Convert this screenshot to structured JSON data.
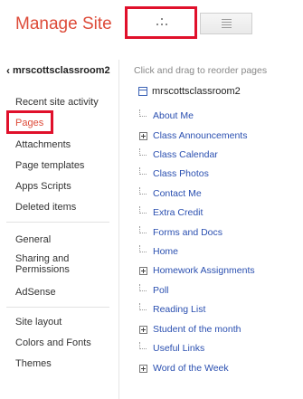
{
  "header": {
    "title": "Manage Site"
  },
  "view_toggle": {
    "tree_label": "Tree view",
    "list_label": "List view",
    "selected": "tree"
  },
  "sidebar": {
    "site_link": "mrscottsclassroom2",
    "groups": [
      [
        "Recent site activity",
        "Pages",
        "Attachments",
        "Page templates",
        "Apps Scripts",
        "Deleted items"
      ],
      [
        "General",
        "Sharing and Permissions",
        "AdSense"
      ],
      [
        "Site layout",
        "Colors and Fonts",
        "Themes"
      ]
    ],
    "active": "Pages"
  },
  "main": {
    "hint": "Click and drag to reorder pages",
    "root": "mrscottsclassroom2",
    "pages": [
      {
        "label": "About Me",
        "expandable": false
      },
      {
        "label": "Class Announcements",
        "expandable": true
      },
      {
        "label": "Class Calendar",
        "expandable": false
      },
      {
        "label": "Class Photos",
        "expandable": false
      },
      {
        "label": "Contact Me",
        "expandable": false
      },
      {
        "label": "Extra Credit",
        "expandable": false
      },
      {
        "label": "Forms and Docs",
        "expandable": false
      },
      {
        "label": "Home",
        "expandable": false
      },
      {
        "label": "Homework Assignments",
        "expandable": true
      },
      {
        "label": "Poll",
        "expandable": false
      },
      {
        "label": "Reading List",
        "expandable": false
      },
      {
        "label": "Student of the month",
        "expandable": true
      },
      {
        "label": "Useful Links",
        "expandable": false
      },
      {
        "label": "Word of the Week",
        "expandable": true
      }
    ]
  },
  "colors": {
    "title": "#dd4b39",
    "link": "#2a4fb0",
    "highlight": "#e0102b"
  }
}
